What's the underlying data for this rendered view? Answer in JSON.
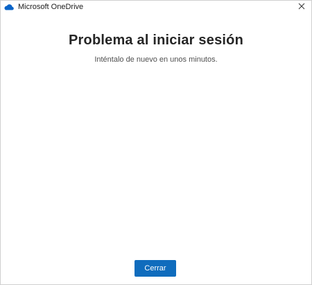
{
  "window": {
    "title": "Microsoft OneDrive",
    "app_icon": "onedrive-cloud-icon",
    "close_icon": "close-icon"
  },
  "dialog": {
    "heading": "Problema al iniciar sesión",
    "message": "Inténtalo de nuevo en unos minutos.",
    "close_button_label": "Cerrar"
  },
  "colors": {
    "accent": "#0f6cbd",
    "cloud": "#0a64c8"
  }
}
